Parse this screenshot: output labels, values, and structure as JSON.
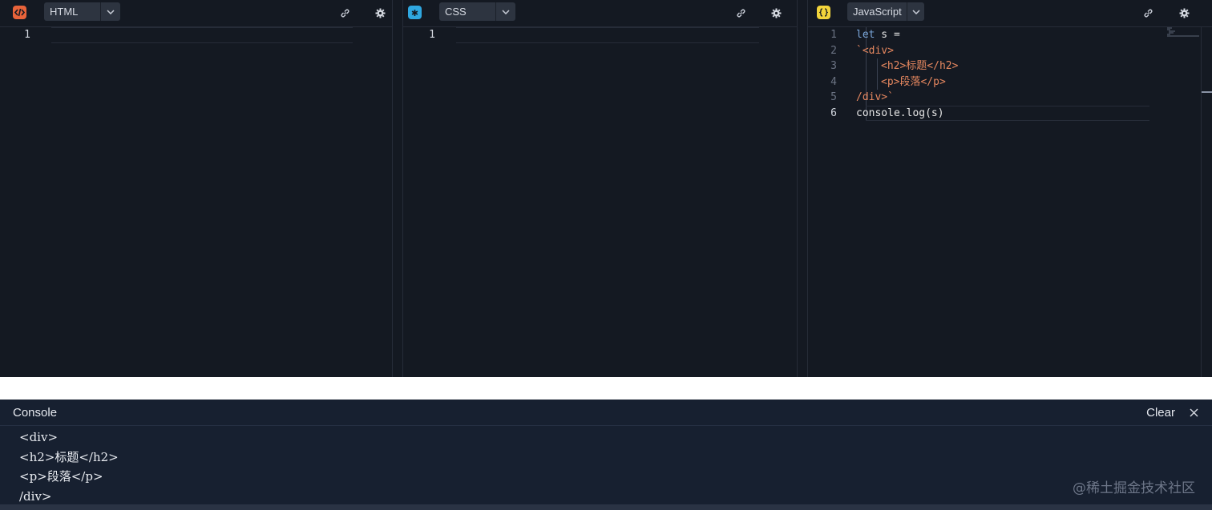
{
  "editors": {
    "html": {
      "language": "HTML",
      "icon": "html-icon",
      "icon_glyph": "</>",
      "icon_color": "#e8633a",
      "lines": [
        {
          "n": "1",
          "text": ""
        }
      ]
    },
    "css": {
      "language": "CSS",
      "icon": "css-icon",
      "icon_glyph": "*",
      "icon_color": "#2fa7e0",
      "lines": [
        {
          "n": "1",
          "text": ""
        }
      ]
    },
    "js": {
      "language": "JavaScript",
      "icon": "javascript-icon",
      "icon_glyph": "()",
      "icon_color": "#f2d43b",
      "lines": [
        {
          "n": "1",
          "kw": "let",
          "rest": " s ="
        },
        {
          "n": "2",
          "str": "`<div>"
        },
        {
          "n": "3",
          "str": "<h2>标题</h2>"
        },
        {
          "n": "4",
          "str": "<p>段落</p>"
        },
        {
          "n": "5",
          "str": "/div>`"
        },
        {
          "n": "6",
          "rest": "console.log(s)"
        }
      ]
    }
  },
  "console": {
    "title": "Console",
    "clear_label": "Clear",
    "output": [
      "<div>",
      "<h2>标题</h2>",
      "<p>段落</p>",
      "/div>"
    ]
  },
  "watermark": "@稀土掘金技术社区",
  "colors": {
    "editor_bg": "#141922",
    "console_bg": "#172030",
    "keyword": "#7aa6da",
    "string": "#e5875f"
  }
}
